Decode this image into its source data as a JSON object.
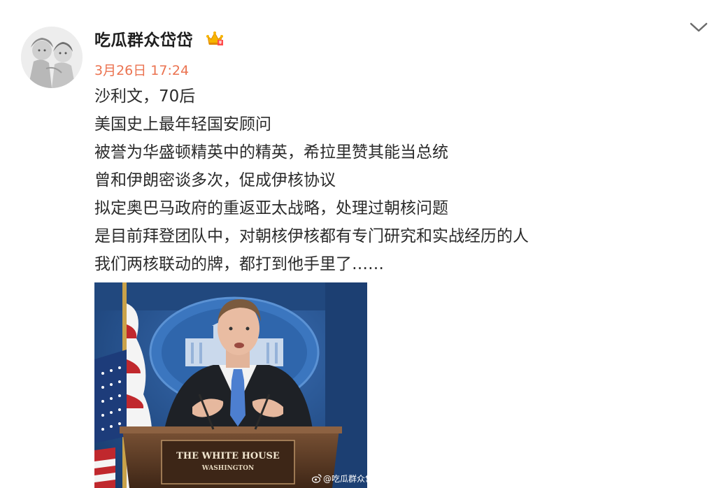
{
  "post": {
    "username": "吃瓜群众岱岱",
    "timestamp": "3月26日 17:24",
    "lines": [
      "沙利文，70后",
      "美国史上最年轻国安顾问",
      "被誉为华盛顿精英中的精英，希拉里赞其能当总统",
      "曾和伊朗密谈多次，促成伊核协议",
      "拟定奥巴马政府的重返亚太战略，处理过朝核问题",
      "是目前拜登团队中，对朝核伊核都有专门研究和实战经历的人",
      "我们两核联动的牌，都打到他手里了……"
    ],
    "badge_icon": "vip-crown-badge-icon",
    "more_icon": "chevron-down-icon"
  },
  "photo": {
    "podium_line1": "THE WHITE HOUSE",
    "podium_line2": "WASHINGTON",
    "watermark": "@吃瓜群众岱"
  },
  "colors": {
    "username": "#1f1f1f",
    "timestamp": "#eb7350",
    "body_text": "#2b2b2b",
    "backdrop_blue": "#2c5a9b",
    "podium_brown": "#5b3a24"
  }
}
